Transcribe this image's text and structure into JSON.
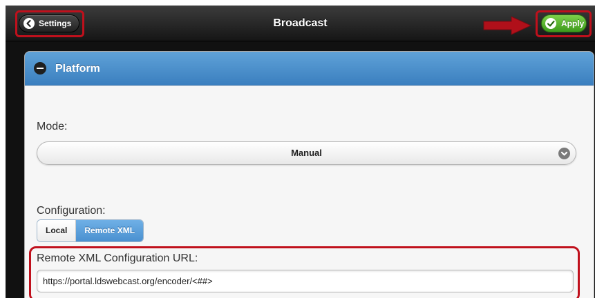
{
  "header": {
    "title": "Broadcast",
    "back_label": "Settings",
    "apply_label": "Apply"
  },
  "panel": {
    "title": "Platform",
    "mode_label": "Mode:",
    "mode_value": "Manual",
    "configuration_label": "Configuration:",
    "configuration_options": [
      "Local",
      "Remote XML"
    ],
    "configuration_selected": "Remote XML",
    "url_label": "Remote XML Configuration URL:",
    "url_value": "https://portal.ldswebcast.org/encoder/<##>"
  },
  "colors": {
    "highlight": "#c0101c",
    "apply_green": "#4caf28",
    "panel_header_blue": "#4a8ccb",
    "selected_segment_blue": "#5aa0dc"
  }
}
